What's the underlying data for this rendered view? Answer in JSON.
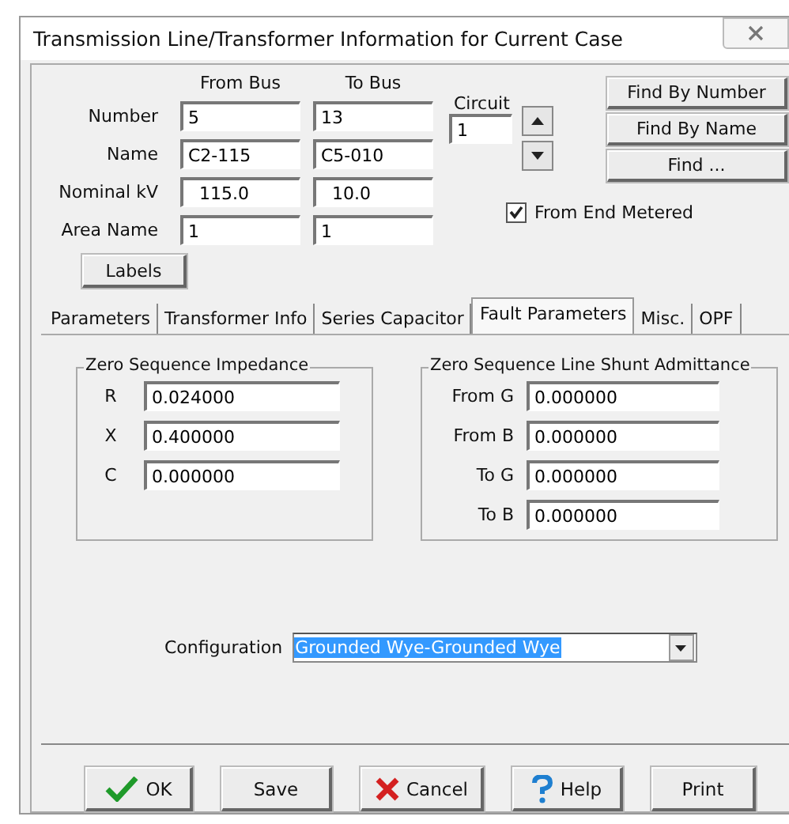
{
  "window": {
    "title": "Transmission Line/Transformer Information for Current Case"
  },
  "bus_headers": [
    "From Bus",
    "To Bus"
  ],
  "bus_rows": [
    {
      "label": "Number",
      "from": "5",
      "to": "13"
    },
    {
      "label": "Name",
      "from": "C2-115",
      "to": "C5-010"
    },
    {
      "label": "Nominal kV",
      "from": "115.0",
      "to": "10.0"
    },
    {
      "label": "Area Name",
      "from": "1",
      "to": "1"
    }
  ],
  "circuit": {
    "label": "Circuit",
    "value": "1"
  },
  "find_buttons": [
    "Find By Number",
    "Find By Name",
    "Find ..."
  ],
  "from_end_metered": {
    "label": "From End Metered",
    "checked": true
  },
  "labels_button": "Labels",
  "tabs": [
    {
      "label": "Parameters",
      "selected": false
    },
    {
      "label": "Transformer Info",
      "selected": false
    },
    {
      "label": "Series Capacitor",
      "selected": false
    },
    {
      "label": "Fault Parameters",
      "selected": true
    },
    {
      "label": "Misc.",
      "selected": false
    },
    {
      "label": "OPF",
      "selected": false
    }
  ],
  "zero_sequence_impedance": {
    "title": "Zero Sequence Impedance",
    "rows": [
      {
        "label": "R",
        "value": "0.024000"
      },
      {
        "label": "X",
        "value": "0.400000"
      },
      {
        "label": "C",
        "value": "0.000000"
      }
    ]
  },
  "shunt_admittance": {
    "title": "Zero Sequence Line Shunt Admittance",
    "rows": [
      {
        "label": "From G",
        "value": "0.000000"
      },
      {
        "label": "From B",
        "value": "0.000000"
      },
      {
        "label": "To G",
        "value": "0.000000"
      },
      {
        "label": "To B",
        "value": "0.000000"
      }
    ]
  },
  "configuration": {
    "label": "Configuration",
    "value": "Grounded Wye-Grounded Wye"
  },
  "buttons": [
    {
      "label": "OK",
      "kind": "ok"
    },
    {
      "label": "Save",
      "kind": "plain"
    },
    {
      "label": "Cancel",
      "kind": "cancel"
    },
    {
      "label": "Help",
      "kind": "help"
    },
    {
      "label": "Print",
      "kind": "plain"
    }
  ]
}
